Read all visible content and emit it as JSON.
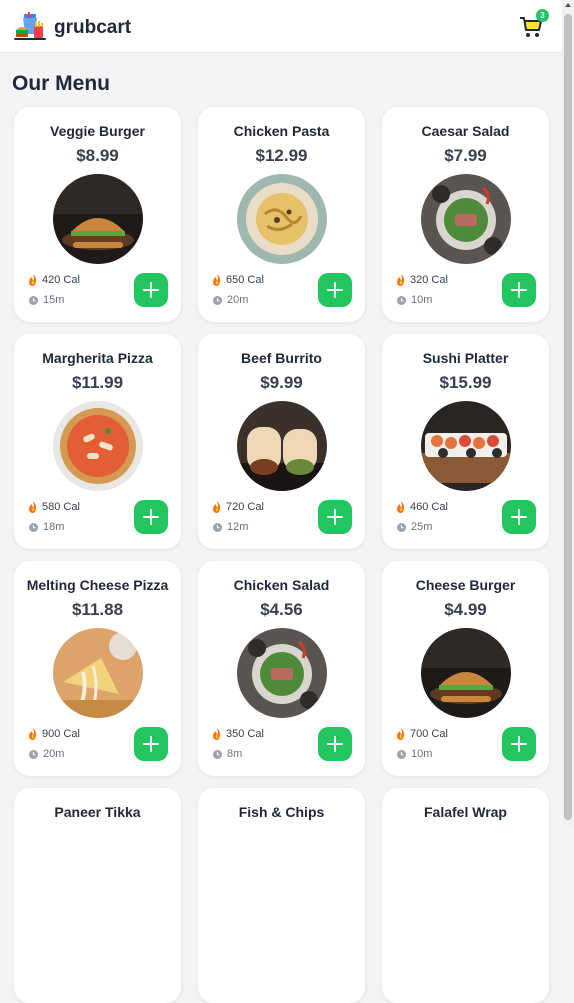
{
  "header": {
    "brand": "grubcart",
    "cart_count": "3"
  },
  "menu": {
    "title": "Our Menu",
    "items": [
      {
        "name": "Veggie Burger",
        "price": "$8.99",
        "calories": "420 Cal",
        "time": "15m",
        "image": "burger"
      },
      {
        "name": "Chicken Pasta",
        "price": "$12.99",
        "calories": "650 Cal",
        "time": "20m",
        "image": "pasta"
      },
      {
        "name": "Caesar Salad",
        "price": "$7.99",
        "calories": "320 Cal",
        "time": "10m",
        "image": "salad"
      },
      {
        "name": "Margherita Pizza",
        "price": "$11.99",
        "calories": "580 Cal",
        "time": "18m",
        "image": "pizza"
      },
      {
        "name": "Beef Burrito",
        "price": "$9.99",
        "calories": "720 Cal",
        "time": "12m",
        "image": "burrito"
      },
      {
        "name": "Sushi Platter",
        "price": "$15.99",
        "calories": "460 Cal",
        "time": "25m",
        "image": "sushi"
      },
      {
        "name": "Melting Cheese Pizza",
        "price": "$11.88",
        "calories": "900 Cal",
        "time": "20m",
        "image": "cheese-pizza"
      },
      {
        "name": "Chicken Salad",
        "price": "$4.56",
        "calories": "350 Cal",
        "time": "8m",
        "image": "salad"
      },
      {
        "name": "Cheese Burger",
        "price": "$4.99",
        "calories": "700 Cal",
        "time": "10m",
        "image": "burger"
      },
      {
        "name": "Paneer Tikka",
        "price": "",
        "calories": "",
        "time": "",
        "image": ""
      },
      {
        "name": "Fish & Chips",
        "price": "",
        "calories": "",
        "time": "",
        "image": ""
      },
      {
        "name": "Falafel Wrap",
        "price": "",
        "calories": "",
        "time": "",
        "image": ""
      }
    ]
  },
  "icons": {
    "logo": "food-logo-icon",
    "cart": "cart-icon",
    "calories": "flame-icon",
    "time": "clock-icon",
    "add": "plus-icon"
  },
  "colors": {
    "accent": "#22c55e",
    "background": "#f3f4f6",
    "card": "#ffffff",
    "text": "#1f2937"
  }
}
